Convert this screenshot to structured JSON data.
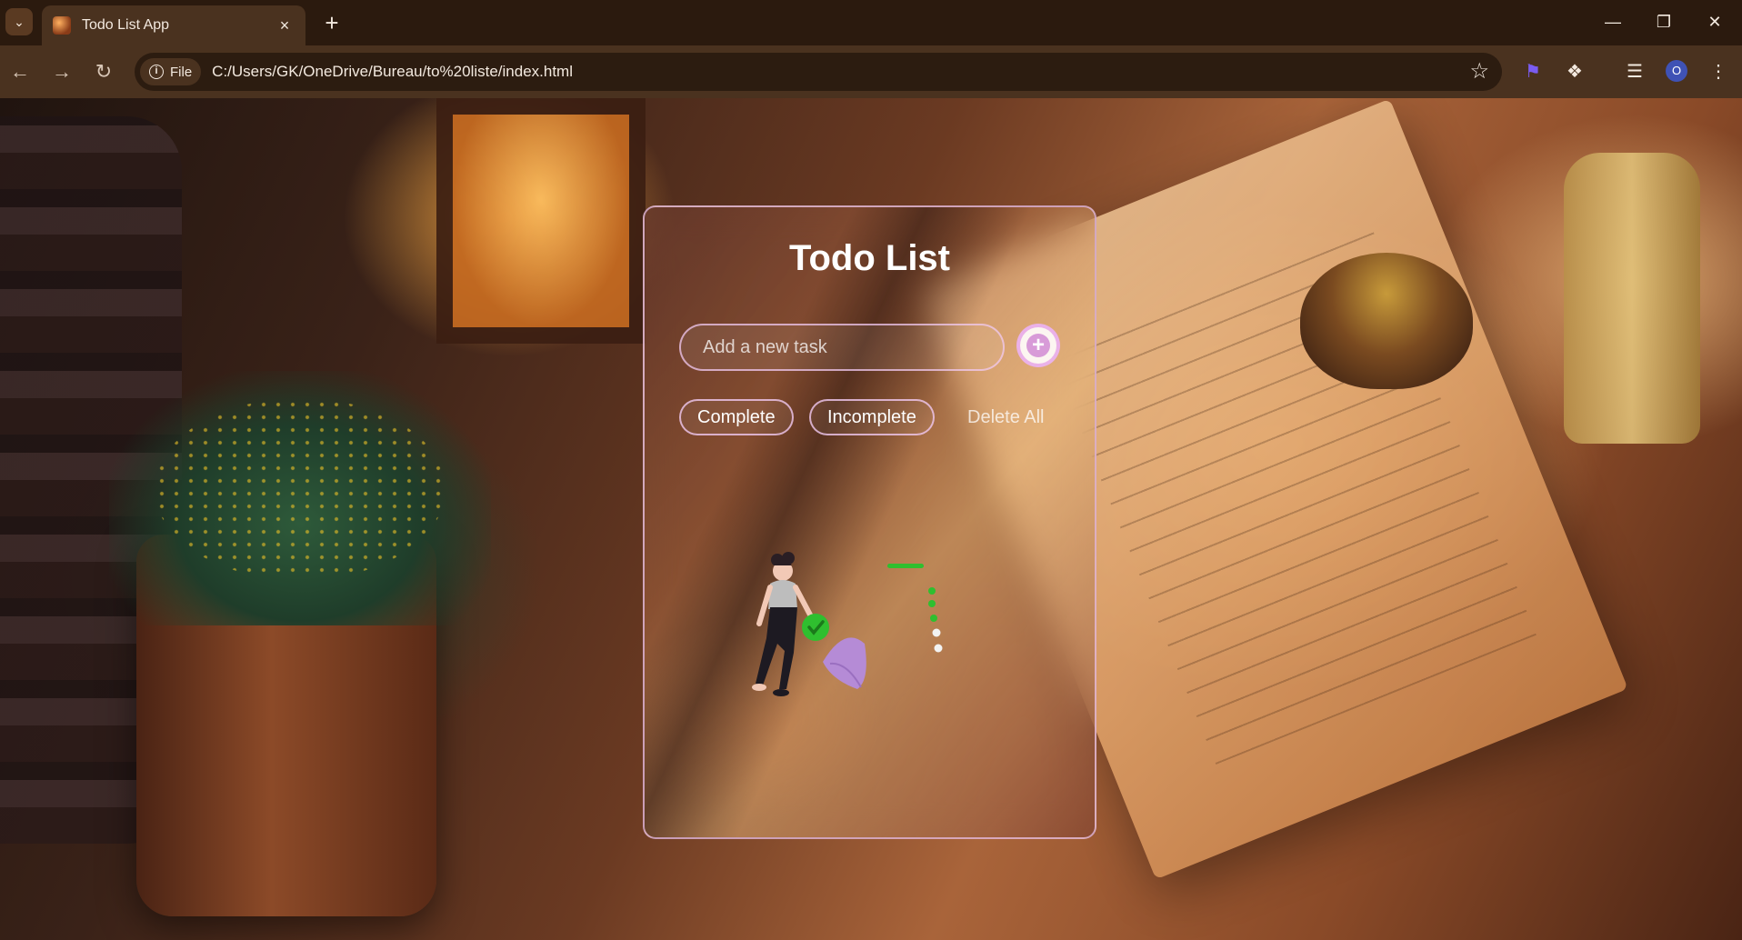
{
  "browser": {
    "tab_title": "Todo List App",
    "tab_close": "×",
    "new_tab": "+",
    "site_chip_label": "File",
    "url": "C:/Users/GK/OneDrive/Bureau/to%20liste/index.html",
    "profile_initial": "O",
    "icons": {
      "tab_search": "chevron-down-icon",
      "back": "arrow-left-icon",
      "forward": "arrow-right-icon",
      "reload": "reload-icon",
      "info": "info-icon",
      "bookmark": "star-icon",
      "extension_flag": "flag-icon",
      "extensions": "puzzle-icon",
      "media": "media-queue-icon",
      "menu": "kebab-menu-icon",
      "minimize": "minimize-icon",
      "restore": "restore-icon",
      "close": "close-icon"
    }
  },
  "todo": {
    "title": "Todo List",
    "input_placeholder": "Add a new task",
    "input_value": "",
    "add_button_icon": "plus-icon",
    "filters": {
      "complete": "Complete",
      "incomplete": "Incomplete",
      "delete_all": "Delete All"
    },
    "empty_state_illustration": "person-with-checklist-illustration"
  },
  "colors": {
    "accent": "#d89bd8",
    "check_green": "#2fbf2f",
    "leaf_purple": "#b58bd6",
    "chrome_dark": "#2b1a0e",
    "chrome_mid": "#4a321f"
  }
}
